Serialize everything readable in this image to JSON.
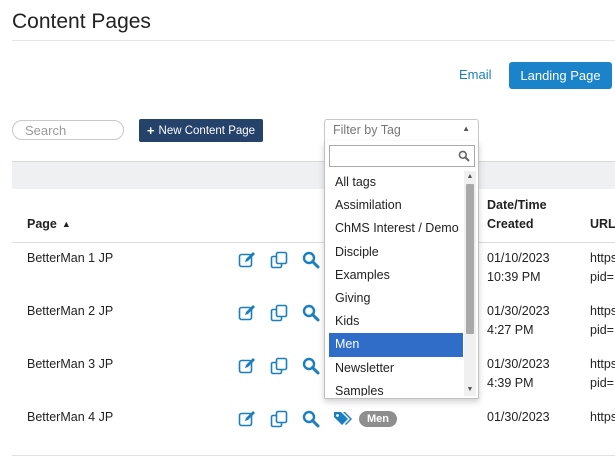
{
  "page": {
    "title": "Content Pages"
  },
  "toolbar": {
    "email_label": "Email",
    "landing_label": "Landing Page",
    "search_placeholder": "Search",
    "new_plus": "+",
    "new_label": "New Content Page"
  },
  "filter": {
    "placeholder": "Filter by Tag",
    "options": [
      "All tags",
      "Assimilation",
      "ChMS Interest / Demo",
      "Disciple",
      "Examples",
      "Giving",
      "Kids",
      "Men",
      "Newsletter",
      "Samples"
    ],
    "selected": "Men"
  },
  "table": {
    "headers": {
      "page": "Page",
      "date_line1": "Date/Time",
      "date_line2": "Created",
      "url": "URL"
    },
    "rows": [
      {
        "name": "BetterMan 1 JP",
        "date": "01/10/2023",
        "time": "10:39 PM",
        "url1": "https",
        "url2": "pid="
      },
      {
        "name": "BetterMan 2 JP",
        "date": "01/30/2023",
        "time": "4:27 PM",
        "url1": "https",
        "url2": "pid="
      },
      {
        "name": "BetterMan 3 JP",
        "date": "01/30/2023",
        "time": "4:39 PM",
        "url1": "https",
        "url2": "pid="
      },
      {
        "name": "BetterMan 4 JP",
        "date": "01/30/2023",
        "time": "",
        "url1": "https",
        "url2": "",
        "tag": "Men"
      }
    ]
  },
  "colors": {
    "accent": "#1a83c9",
    "primary_dark": "#24426a",
    "selected": "#2f6dc9"
  },
  "icons": [
    "edit-icon",
    "copy-icon",
    "preview-icon",
    "tag-icon",
    "search-icon",
    "sort-up-icon",
    "caret-up-icon"
  ]
}
